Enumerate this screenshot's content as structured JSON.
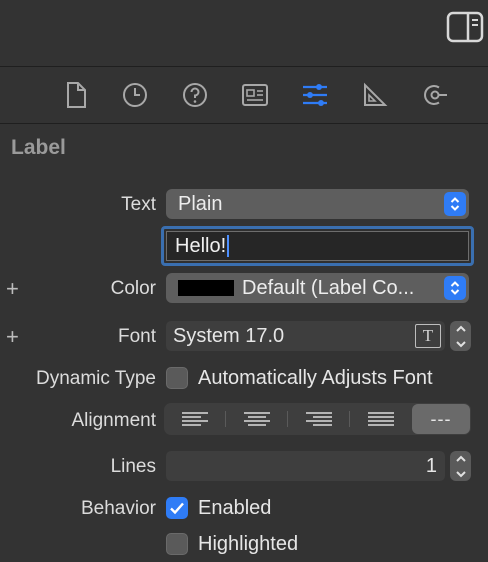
{
  "topbar": {
    "inspector_toggle_icon": "sidebar-right-icon"
  },
  "tabs": [
    {
      "icon": "file-icon"
    },
    {
      "icon": "clock-icon"
    },
    {
      "icon": "help-icon"
    },
    {
      "icon": "identity-card-icon"
    },
    {
      "icon": "sliders-icon",
      "selected": true
    },
    {
      "icon": "ruler-icon"
    },
    {
      "icon": "connections-icon"
    }
  ],
  "section": {
    "title": "Label"
  },
  "text_row": {
    "label": "Text",
    "type_value": "Plain",
    "field_value": "Hello!"
  },
  "color_row": {
    "label": "Color",
    "value": "Default (Label Co...",
    "swatch": "#000000"
  },
  "font_row": {
    "label": "Font",
    "value": "System 17.0",
    "picker_glyph": "T"
  },
  "dynamic_type_row": {
    "label": "Dynamic Type",
    "checkbox_label": "Automatically Adjusts Font",
    "checked": false
  },
  "alignment_row": {
    "label": "Alignment",
    "options": [
      "left",
      "center",
      "right",
      "justified",
      "natural"
    ],
    "natural_glyph": "---",
    "selected": "natural"
  },
  "lines_row": {
    "label": "Lines",
    "value": "1"
  },
  "behavior_row": {
    "label": "Behavior",
    "enabled_label": "Enabled",
    "enabled_checked": true,
    "highlighted_label": "Highlighted",
    "highlighted_checked": false
  },
  "plus_glyph": "+",
  "colors": {
    "accent": "#2f7cf6",
    "background": "#333333",
    "focus_ring": "#3a6fb0"
  }
}
